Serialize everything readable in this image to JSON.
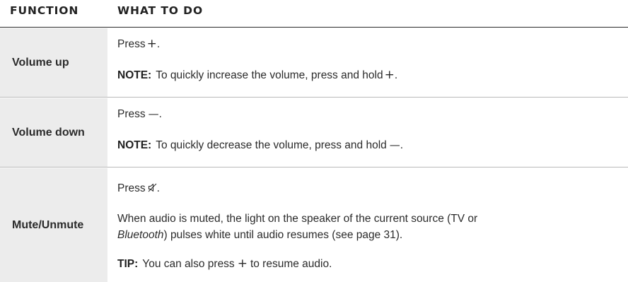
{
  "header": {
    "function_label": "FUNCTION",
    "what_to_do_label": "WHAT TO DO"
  },
  "rows": [
    {
      "function": "Volume up",
      "lines": [
        {
          "text": "Press",
          "symbol": "+",
          "suffix": "."
        },
        {
          "label": "NOTE:",
          "text": "To quickly increase the volume, press and hold",
          "symbol": "+",
          "suffix": "."
        }
      ]
    },
    {
      "function": "Volume down",
      "lines": [
        {
          "text": "Press",
          "symbol": "—",
          "suffix": "."
        },
        {
          "label": "NOTE:",
          "text": "To quickly decrease the volume, press and hold",
          "symbol": "—",
          "suffix": "."
        }
      ]
    },
    {
      "function": "Mute/Unmute",
      "lines": [
        {
          "text": "Press",
          "icon": "mute-icon",
          "suffix": "."
        },
        {
          "text": "When audio is muted, the light on the speaker of the current source (TV or"
        },
        {
          "italic": "Bluetooth",
          "text": ") pulses white until audio resumes (see page 31)."
        },
        {
          "label": "TIP:",
          "text": "You can also press",
          "symbol": "+",
          "suffix": "to resume audio."
        }
      ]
    }
  ],
  "colors": {
    "text": "#2b2b2b",
    "function_cell_bg": "#ececec",
    "header_rule": "#2b2b2b",
    "row_divider": "#b9b9b9"
  }
}
